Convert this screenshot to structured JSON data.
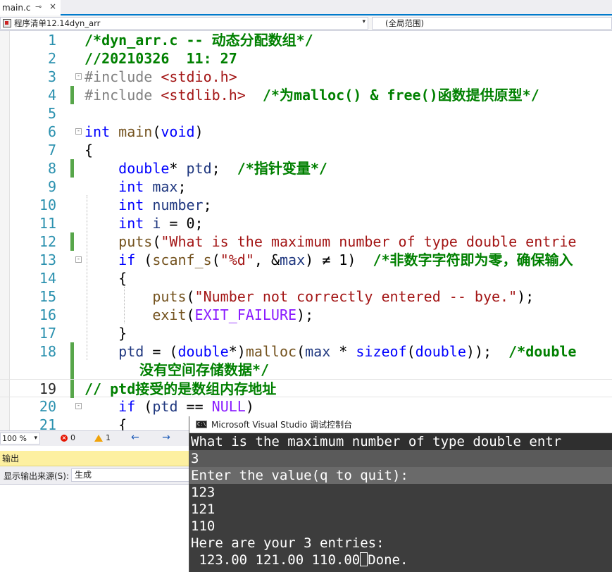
{
  "tab": {
    "filename": "main.c",
    "pin_glyph": "⊸",
    "close_glyph": "×"
  },
  "navbar": {
    "project": "程序清单12.14dyn_arr",
    "scope": "(全局范围)"
  },
  "editor": {
    "lines": [
      {
        "n": "1"
      },
      {
        "n": "2"
      },
      {
        "n": "3"
      },
      {
        "n": "4"
      },
      {
        "n": "5"
      },
      {
        "n": "6"
      },
      {
        "n": "7"
      },
      {
        "n": "8"
      },
      {
        "n": "9"
      },
      {
        "n": "10"
      },
      {
        "n": "11"
      },
      {
        "n": "12"
      },
      {
        "n": "13"
      },
      {
        "n": "14"
      },
      {
        "n": "15"
      },
      {
        "n": "16"
      },
      {
        "n": "17"
      },
      {
        "n": "18"
      },
      {
        "n": "19"
      },
      {
        "n": "20"
      },
      {
        "n": "21"
      }
    ],
    "code": {
      "l1": "/*dyn_arr.c -- 动态分配数组*/",
      "l2": "//20210326  11: 27",
      "l3_pp": "#include ",
      "l3_inc": "<stdio.h>",
      "l4_pp": "#include ",
      "l4_inc": "<stdlib.h>",
      "l4_cm": "  /*为malloc() & free()函数提供原型*/",
      "l6_kw": "int",
      "l6_fn": "main",
      "l6_p1": "(",
      "l6_kw2": "void",
      "l6_p2": ")",
      "l7": "{",
      "l8_kw": "double",
      "l8_rest": "* ",
      "l8_var": "ptd",
      "l8_semi": ";  ",
      "l8_cm": "/*指针变量*/",
      "l9_kw": "int",
      "l9_var": "max",
      "l9_semi": ";",
      "l10_kw": "int",
      "l10_var": "number",
      "l10_semi": ";",
      "l11_kw": "int",
      "l11_var": "i",
      "l11_rest": " = 0;",
      "l12_fn": "puts",
      "l12_p": "(",
      "l12_str": "\"What is the maximum number of type double entrie",
      "l13_kw": "if",
      "l13_p1": " (",
      "l13_fn": "scanf_s",
      "l13_p2": "(",
      "l13_str": "\"%d\"",
      "l13_p3": ", &",
      "l13_var": "max",
      "l13_p4": ") ≠ 1)  ",
      "l13_cm": "/*非数字字符即为零，确保输入",
      "l14": "{",
      "l15_fn": "puts",
      "l15_p": "(",
      "l15_str": "\"Number not correctly entered -- bye.\"",
      "l15_end": ");",
      "l16_fn": "exit",
      "l16_p": "(",
      "l16_mac": "EXIT_FAILURE",
      "l16_end": ");",
      "l17": "}",
      "l18_var": "ptd",
      "l18_a": " = (",
      "l18_kw": "double",
      "l18_b": "*)",
      "l18_fn": "malloc",
      "l18_c": "(",
      "l18_var2": "max",
      "l18_d": " * ",
      "l18_kw2": "sizeof",
      "l18_e": "(",
      "l18_kw3": "double",
      "l18_f": "));  ",
      "l18_cm": "/*double",
      "l18_wrap": "没有空间存储数据*/",
      "l19_cm": "// ptd接受的是数组内存地址",
      "l20_kw": "if",
      "l20_a": " (",
      "l20_var": "ptd",
      "l20_b": " == ",
      "l20_mac": "NULL",
      "l20_c": ")",
      "l21": "{"
    }
  },
  "status": {
    "zoom": "100 %",
    "errors": "0",
    "warnings": "1",
    "nav_arrows": "← →"
  },
  "output": {
    "title": "输出",
    "source_label": "显示输出来源(S):",
    "source_value": "生成"
  },
  "console": {
    "icon_text": "C:\\",
    "title": "Microsoft Visual Studio 调试控制台",
    "lines": [
      "What is the maximum number of type double entr",
      "3",
      "Enter the value(q to quit):",
      "123",
      "121",
      "110",
      "Here are your 3 entries:",
      " 123.00 121.00 110.00"
    ],
    "tail": "Done."
  }
}
